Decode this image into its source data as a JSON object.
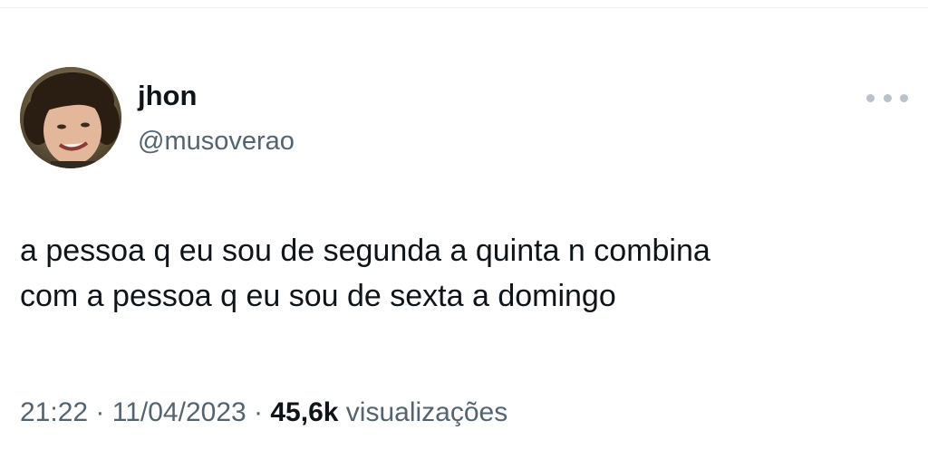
{
  "tweet": {
    "author": {
      "display_name": "jhon",
      "handle": "@musoverao",
      "avatar_icon": "profile-photo"
    },
    "more_icon": "more-horizontal-icon",
    "text": "a pessoa q eu sou de segunda a quinta n combina\ncom a pessoa q eu sou de sexta a domingo",
    "time": "21:22",
    "separator": "·",
    "date": "11/04/2023",
    "views_count": "45,6k",
    "views_label": "visualizações"
  },
  "colors": {
    "text_primary": "#0f1419",
    "text_secondary": "#536471",
    "icon_muted": "#b9c2ca"
  }
}
